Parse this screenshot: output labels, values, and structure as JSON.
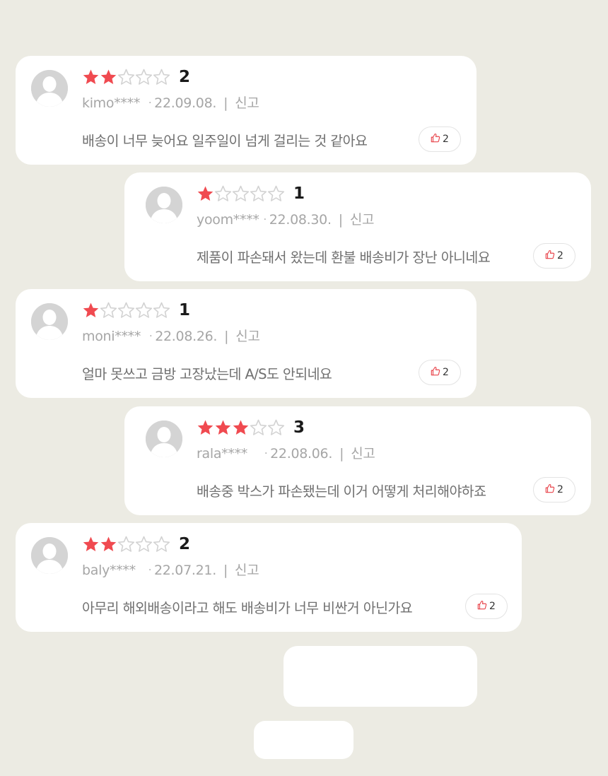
{
  "colors": {
    "background": "#ecebe3",
    "card": "#ffffff",
    "star_filled": "#f04a50",
    "star_empty": "#d2d2d2",
    "like_icon": "#e8434a"
  },
  "icons": {
    "avatar": "default-user-icon",
    "star": "star-icon",
    "like": "thumbs-up-icon"
  },
  "reviews": [
    {
      "rating": 2,
      "score_label": "2",
      "user": "kimo****",
      "dot": "·",
      "date": "22.09.08.",
      "separator": "|",
      "report_label": "신고",
      "comment": "배송이 너무 늦어요 일주일이 넘게 걸리는 것 같아요",
      "likes": "2"
    },
    {
      "rating": 1,
      "score_label": "1",
      "user": "yoom****",
      "dot": "·",
      "date": "22.08.30.",
      "separator": "|",
      "report_label": "신고",
      "comment": "제품이 파손돼서 왔는데 환불 배송비가 장난 아니네요",
      "likes": "2"
    },
    {
      "rating": 1,
      "score_label": "1",
      "user": "moni****",
      "dot": "·",
      "date": "22.08.26.",
      "separator": "|",
      "report_label": "신고",
      "comment": "얼마 못쓰고 금방 고장났는데 A/S도 안되네요",
      "likes": "2"
    },
    {
      "rating": 3,
      "score_label": "3",
      "user": "rala****",
      "dot": "·",
      "date": "22.08.06.",
      "separator": "|",
      "report_label": "신고",
      "comment": "배송중 박스가 파손됐는데 이거 어떻게 처리해야하죠",
      "likes": "2"
    },
    {
      "rating": 2,
      "score_label": "2",
      "user": "baly****",
      "dot": "·",
      "date": "22.07.21.",
      "separator": "|",
      "report_label": "신고",
      "comment": "아무리 해외배송이라고 해도 배송비가 너무 비싼거 아닌가요",
      "likes": "2"
    }
  ]
}
